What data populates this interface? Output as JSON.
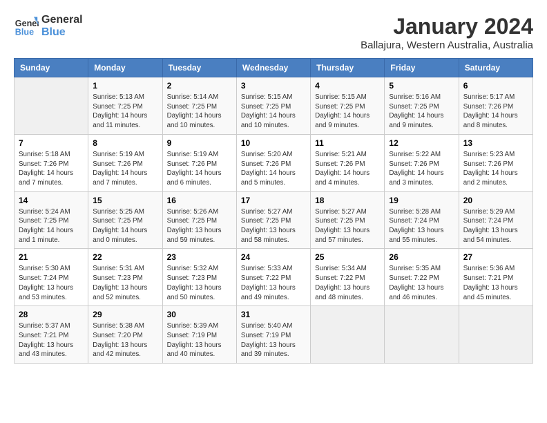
{
  "header": {
    "logo_line1": "General",
    "logo_line2": "Blue",
    "month": "January 2024",
    "location": "Ballajura, Western Australia, Australia"
  },
  "columns": [
    "Sunday",
    "Monday",
    "Tuesday",
    "Wednesday",
    "Thursday",
    "Friday",
    "Saturday"
  ],
  "weeks": [
    [
      {
        "day": "",
        "info": ""
      },
      {
        "day": "1",
        "info": "Sunrise: 5:13 AM\nSunset: 7:25 PM\nDaylight: 14 hours\nand 11 minutes."
      },
      {
        "day": "2",
        "info": "Sunrise: 5:14 AM\nSunset: 7:25 PM\nDaylight: 14 hours\nand 10 minutes."
      },
      {
        "day": "3",
        "info": "Sunrise: 5:15 AM\nSunset: 7:25 PM\nDaylight: 14 hours\nand 10 minutes."
      },
      {
        "day": "4",
        "info": "Sunrise: 5:15 AM\nSunset: 7:25 PM\nDaylight: 14 hours\nand 9 minutes."
      },
      {
        "day": "5",
        "info": "Sunrise: 5:16 AM\nSunset: 7:25 PM\nDaylight: 14 hours\nand 9 minutes."
      },
      {
        "day": "6",
        "info": "Sunrise: 5:17 AM\nSunset: 7:26 PM\nDaylight: 14 hours\nand 8 minutes."
      }
    ],
    [
      {
        "day": "7",
        "info": "Sunrise: 5:18 AM\nSunset: 7:26 PM\nDaylight: 14 hours\nand 7 minutes."
      },
      {
        "day": "8",
        "info": "Sunrise: 5:19 AM\nSunset: 7:26 PM\nDaylight: 14 hours\nand 7 minutes."
      },
      {
        "day": "9",
        "info": "Sunrise: 5:19 AM\nSunset: 7:26 PM\nDaylight: 14 hours\nand 6 minutes."
      },
      {
        "day": "10",
        "info": "Sunrise: 5:20 AM\nSunset: 7:26 PM\nDaylight: 14 hours\nand 5 minutes."
      },
      {
        "day": "11",
        "info": "Sunrise: 5:21 AM\nSunset: 7:26 PM\nDaylight: 14 hours\nand 4 minutes."
      },
      {
        "day": "12",
        "info": "Sunrise: 5:22 AM\nSunset: 7:26 PM\nDaylight: 14 hours\nand 3 minutes."
      },
      {
        "day": "13",
        "info": "Sunrise: 5:23 AM\nSunset: 7:26 PM\nDaylight: 14 hours\nand 2 minutes."
      }
    ],
    [
      {
        "day": "14",
        "info": "Sunrise: 5:24 AM\nSunset: 7:25 PM\nDaylight: 14 hours\nand 1 minute."
      },
      {
        "day": "15",
        "info": "Sunrise: 5:25 AM\nSunset: 7:25 PM\nDaylight: 14 hours\nand 0 minutes."
      },
      {
        "day": "16",
        "info": "Sunrise: 5:26 AM\nSunset: 7:25 PM\nDaylight: 13 hours\nand 59 minutes."
      },
      {
        "day": "17",
        "info": "Sunrise: 5:27 AM\nSunset: 7:25 PM\nDaylight: 13 hours\nand 58 minutes."
      },
      {
        "day": "18",
        "info": "Sunrise: 5:27 AM\nSunset: 7:25 PM\nDaylight: 13 hours\nand 57 minutes."
      },
      {
        "day": "19",
        "info": "Sunrise: 5:28 AM\nSunset: 7:24 PM\nDaylight: 13 hours\nand 55 minutes."
      },
      {
        "day": "20",
        "info": "Sunrise: 5:29 AM\nSunset: 7:24 PM\nDaylight: 13 hours\nand 54 minutes."
      }
    ],
    [
      {
        "day": "21",
        "info": "Sunrise: 5:30 AM\nSunset: 7:24 PM\nDaylight: 13 hours\nand 53 minutes."
      },
      {
        "day": "22",
        "info": "Sunrise: 5:31 AM\nSunset: 7:23 PM\nDaylight: 13 hours\nand 52 minutes."
      },
      {
        "day": "23",
        "info": "Sunrise: 5:32 AM\nSunset: 7:23 PM\nDaylight: 13 hours\nand 50 minutes."
      },
      {
        "day": "24",
        "info": "Sunrise: 5:33 AM\nSunset: 7:22 PM\nDaylight: 13 hours\nand 49 minutes."
      },
      {
        "day": "25",
        "info": "Sunrise: 5:34 AM\nSunset: 7:22 PM\nDaylight: 13 hours\nand 48 minutes."
      },
      {
        "day": "26",
        "info": "Sunrise: 5:35 AM\nSunset: 7:22 PM\nDaylight: 13 hours\nand 46 minutes."
      },
      {
        "day": "27",
        "info": "Sunrise: 5:36 AM\nSunset: 7:21 PM\nDaylight: 13 hours\nand 45 minutes."
      }
    ],
    [
      {
        "day": "28",
        "info": "Sunrise: 5:37 AM\nSunset: 7:21 PM\nDaylight: 13 hours\nand 43 minutes."
      },
      {
        "day": "29",
        "info": "Sunrise: 5:38 AM\nSunset: 7:20 PM\nDaylight: 13 hours\nand 42 minutes."
      },
      {
        "day": "30",
        "info": "Sunrise: 5:39 AM\nSunset: 7:19 PM\nDaylight: 13 hours\nand 40 minutes."
      },
      {
        "day": "31",
        "info": "Sunrise: 5:40 AM\nSunset: 7:19 PM\nDaylight: 13 hours\nand 39 minutes."
      },
      {
        "day": "",
        "info": ""
      },
      {
        "day": "",
        "info": ""
      },
      {
        "day": "",
        "info": ""
      }
    ]
  ]
}
